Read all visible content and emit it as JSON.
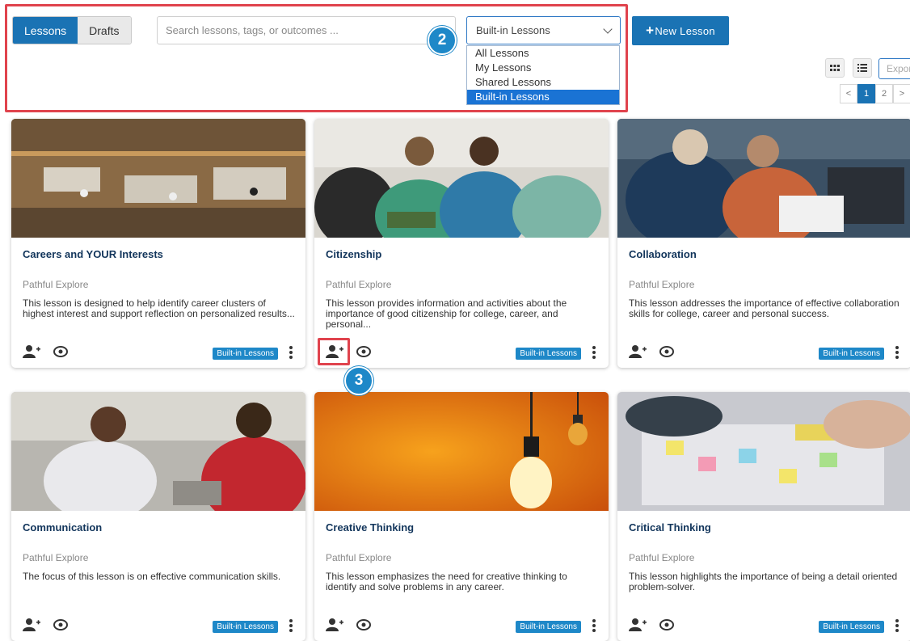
{
  "tabs": [
    {
      "label": "Lessons",
      "active": true
    },
    {
      "label": "Drafts",
      "active": false
    }
  ],
  "search": {
    "placeholder": "Search lessons, tags, or outcomes ..."
  },
  "filter": {
    "selected": "Built-in Lessons",
    "options": [
      "All Lessons",
      "My Lessons",
      "Shared Lessons",
      "Built-in Lessons"
    ]
  },
  "new_button": {
    "plus": "+",
    "label": "New Lesson"
  },
  "export": {
    "placeholder": "Expor"
  },
  "pager": {
    "prev": "<",
    "pages": [
      "1",
      "2"
    ],
    "next": ">",
    "current": "1"
  },
  "steps": {
    "step2": "2",
    "step3": "3"
  },
  "colors": {
    "accent": "#1a73b4",
    "highlight": "#e0434d",
    "badge": "#1e88c8",
    "title": "#12355b"
  },
  "cards": [
    {
      "title": "Careers and YOUR Interests",
      "provider": "Pathful Explore",
      "description": "This lesson is designed to help identify career clusters of highest interest and support reflection on personalized results...",
      "badge": "Built-in Lessons",
      "image": "office-workspace-photo"
    },
    {
      "title": "Citizenship",
      "provider": "Pathful Explore",
      "description": "This lesson provides information and activities about the importance of good citizenship for college, career, and personal...",
      "badge": "Built-in Lessons",
      "image": "group-reading-photo"
    },
    {
      "title": "Collaboration",
      "provider": "Pathful Explore",
      "description": "This lesson addresses the importance of effective collaboration skills for college, career and personal success.",
      "badge": "Built-in Lessons",
      "image": "women-laptop-photo"
    },
    {
      "title": "Communication",
      "provider": "Pathful Explore",
      "description": "The focus of this lesson is on effective communication skills.",
      "badge": "Built-in Lessons",
      "image": "two-women-talking-photo"
    },
    {
      "title": "Creative Thinking",
      "provider": "Pathful Explore",
      "description": "This lesson emphasizes the need for creative thinking to identify and solve problems in any career.",
      "badge": "Built-in Lessons",
      "image": "light-bulb-photo"
    },
    {
      "title": "Critical Thinking",
      "provider": "Pathful Explore",
      "description": "This lesson highlights the importance of being a detail oriented problem-solver.",
      "badge": "Built-in Lessons",
      "image": "sticky-notes-planning-photo"
    }
  ]
}
